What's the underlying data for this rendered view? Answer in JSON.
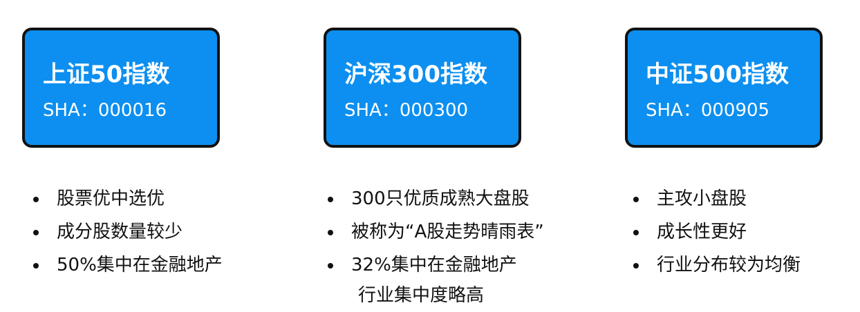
{
  "cards": [
    {
      "title": "上证50指数",
      "code": "SHA：000016",
      "bullets": [
        "股票优中选优",
        "成分股数量较少",
        "50%集中在金融地产"
      ]
    },
    {
      "title": "沪深300指数",
      "code": "SHA：000300",
      "bullets": [
        "300只优质成熟大盘股",
        "被称为“A股走势晴雨表”",
        "32%集中在金融地产"
      ],
      "bullet_continuation": "行业集中度略高"
    },
    {
      "title": "中证500指数",
      "code": "SHA：000905",
      "bullets": [
        "主攻小盘股",
        "成长性更好",
        "行业分布较为均衡"
      ]
    }
  ],
  "colors": {
    "card_fill": "#0c8ff0",
    "card_border": "#111111",
    "card_text": "#ffffff",
    "body_text": "#111111"
  }
}
